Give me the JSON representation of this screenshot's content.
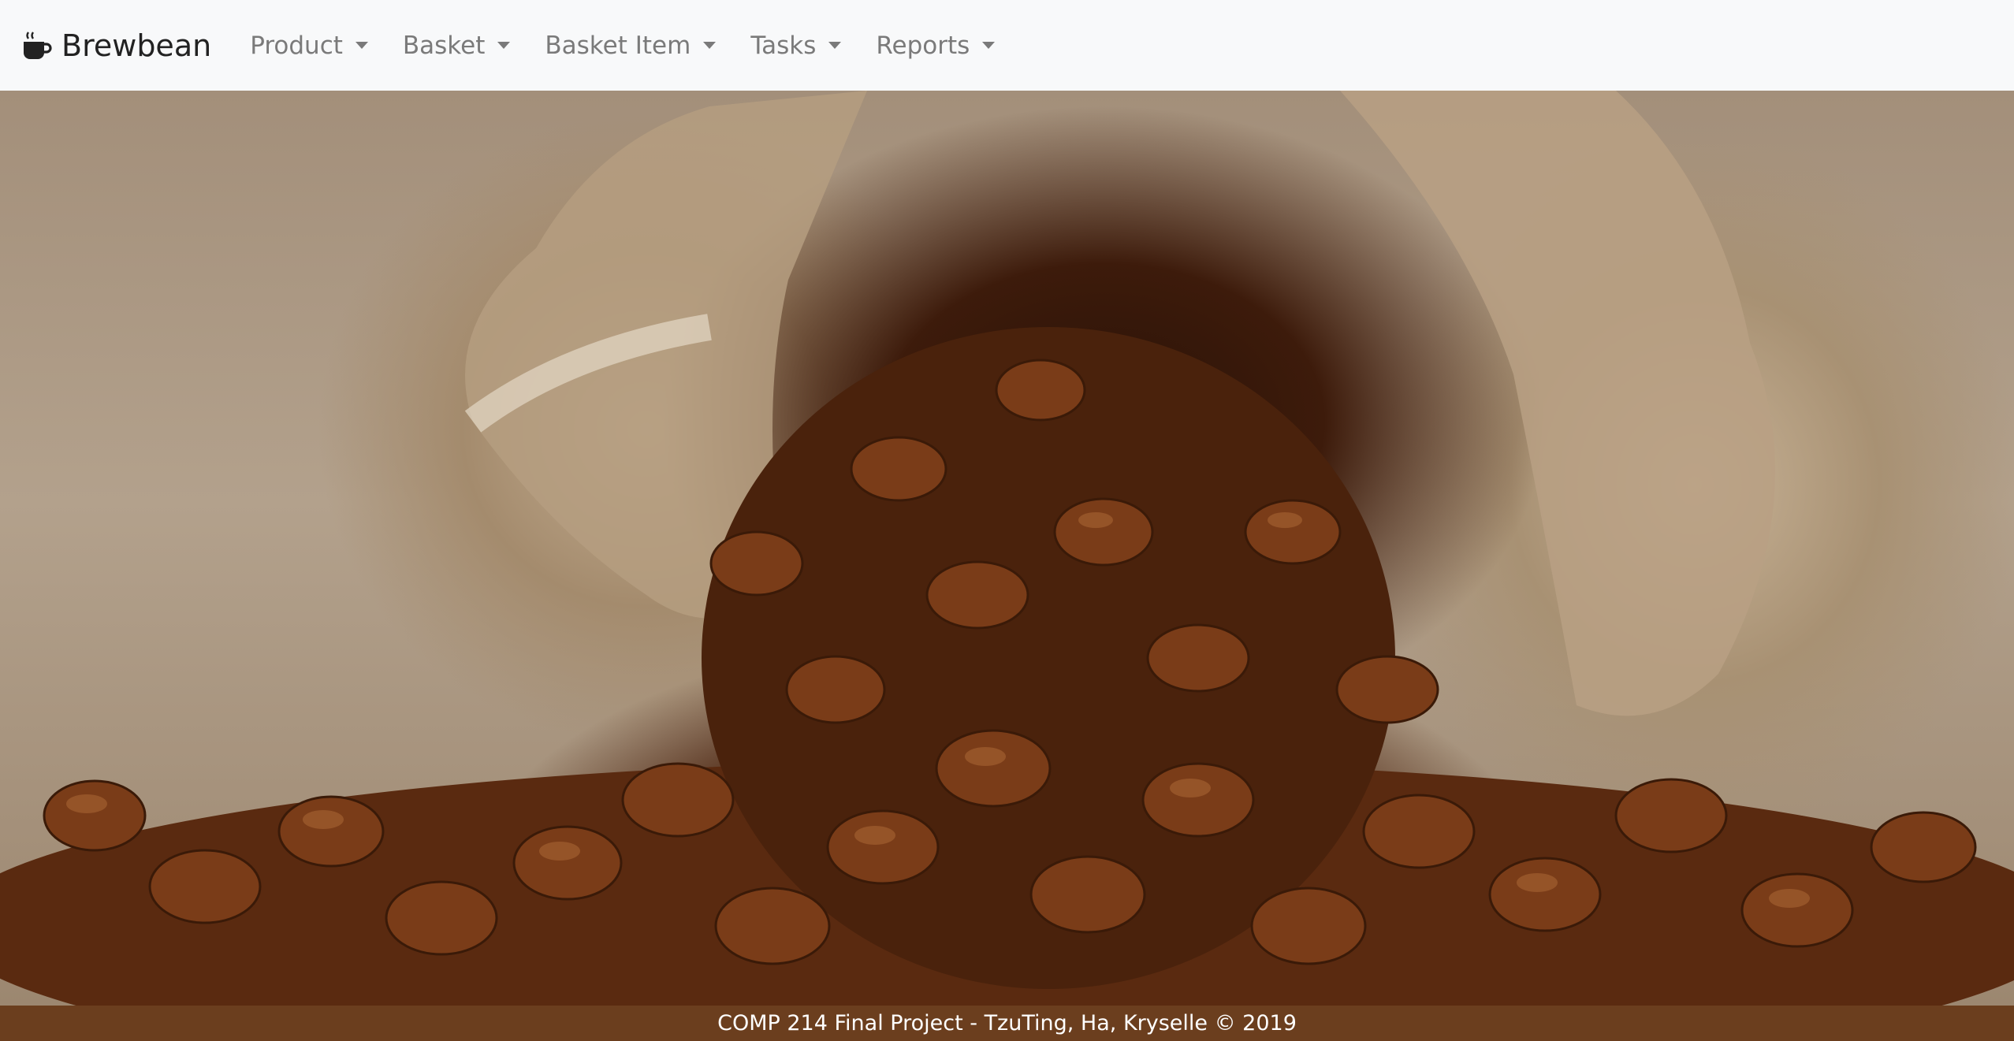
{
  "brand": {
    "name": "Brewbean",
    "icon": "coffee-cup-icon"
  },
  "nav": {
    "items": [
      {
        "label": "Product"
      },
      {
        "label": "Basket"
      },
      {
        "label": "Basket Item"
      },
      {
        "label": "Tasks"
      },
      {
        "label": "Reports"
      }
    ]
  },
  "footer": {
    "text": "COMP 214 Final Project - TzuTing, Ha, Kryselle © 2019"
  },
  "colors": {
    "navbar_bg": "#f8f9fa",
    "nav_text": "#7a7a7a",
    "footer_bg": "#6b3e1e",
    "footer_text": "#ffffff"
  }
}
